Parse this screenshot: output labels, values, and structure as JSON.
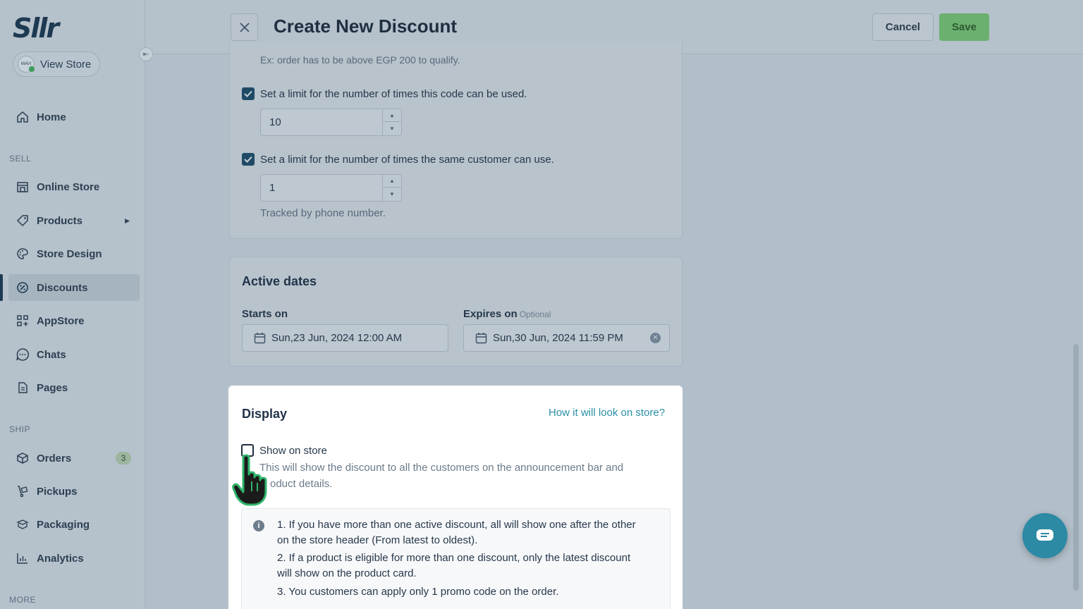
{
  "app": {
    "logo_text": "Sllr",
    "accent_color": "#1e3a52",
    "save_color": "#6bb06f"
  },
  "sidebar": {
    "view_store_label": "View Store",
    "avatar_text": "MAVI",
    "sections": {
      "sell": "SELL",
      "ship": "SHIP",
      "more": "MORE"
    },
    "items": [
      {
        "label": "Home",
        "icon": "home-icon"
      },
      {
        "label": "Online Store",
        "icon": "store-icon"
      },
      {
        "label": "Products",
        "icon": "tag-icon"
      },
      {
        "label": "Store Design",
        "icon": "palette-icon"
      },
      {
        "label": "Discounts",
        "icon": "discount-icon",
        "active": true
      },
      {
        "label": "AppStore",
        "icon": "apps-icon"
      },
      {
        "label": "Chats",
        "icon": "chat-icon"
      },
      {
        "label": "Pages",
        "icon": "pages-icon"
      },
      {
        "label": "Orders",
        "icon": "box-icon",
        "badge": "3"
      },
      {
        "label": "Pickups",
        "icon": "dolly-icon"
      },
      {
        "label": "Packaging",
        "icon": "package-icon"
      },
      {
        "label": "Analytics",
        "icon": "chart-icon"
      }
    ]
  },
  "header": {
    "title": "Create New Discount",
    "cancel_label": "Cancel",
    "save_label": "Save"
  },
  "limits": {
    "min_hint": "Ex: order has to be above EGP 200 to qualify.",
    "total_limit_label": "Set a limit for the number of times this code can be used.",
    "total_limit_checked": true,
    "total_limit_value": "10",
    "customer_limit_label": "Set a limit for the number of times the same customer can use.",
    "customer_limit_checked": true,
    "customer_limit_value": "1",
    "tracked_note": "Tracked by phone number."
  },
  "active_dates": {
    "title": "Active dates",
    "starts_label": "Starts on",
    "starts_value": "Sun,23 Jun, 2024 12:00 AM",
    "expires_label": "Expires on",
    "expires_optional": "Optional",
    "expires_value": "Sun,30 Jun, 2024 11:59 PM"
  },
  "display": {
    "title": "Display",
    "preview_link": "How it will look on store?",
    "show_on_store_label": "Show on store",
    "show_on_store_checked": false,
    "desc_line1": "This will show the discount to all the customers on the announcement bar and",
    "desc_line2": "oduct details.",
    "info_1a": "1. If you have more than one active discount, all will show one after the other",
    "info_1b": "on the store header (From latest to oldest).",
    "info_2a": "2. If a product is eligible for more than one discount, only the latest discount",
    "info_2b": "will show on the product card.",
    "info_3": "3. You customers can apply only 1 promo code on the order."
  }
}
